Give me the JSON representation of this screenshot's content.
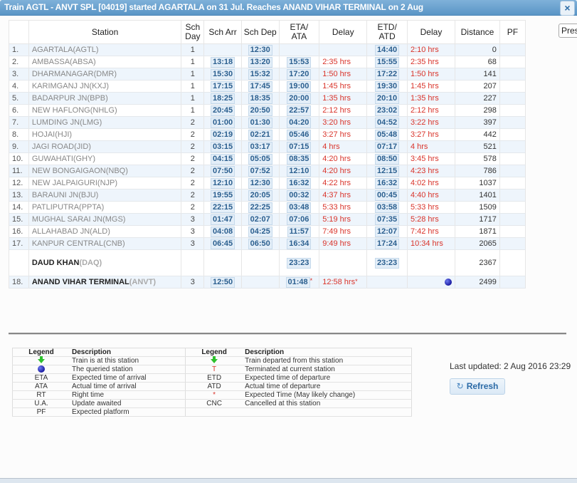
{
  "dialog": {
    "title": "Train AGTL - ANVT SPL [04019] started AGARTALA on 31 Jul. Reaches ANAND VIHAR TERMINAL on 2 Aug",
    "close_icon": "×",
    "side_button_label": "Pres"
  },
  "table": {
    "headers": {
      "num": "",
      "station": "Station",
      "sch_day": "Sch Day",
      "sch_arr": "Sch Arr",
      "sch_dep": "Sch Dep",
      "eta_ata": "ETA/ ATA",
      "arr_delay": "Delay",
      "etd_atd": "ETD/ ATD",
      "dep_delay": "Delay",
      "distance": "Distance",
      "pf": "PF"
    },
    "rows": [
      {
        "num": "1.",
        "station": "AGARTALA(AGTL)",
        "day": "1",
        "sch_arr": "",
        "sch_dep": "12:30",
        "eta": "",
        "arr_delay": "",
        "etd": "14:40",
        "dep_delay": "2:10 hrs",
        "distance": "0",
        "pf": ""
      },
      {
        "num": "2.",
        "station": "AMBASSA(ABSA)",
        "day": "1",
        "sch_arr": "13:18",
        "sch_dep": "13:20",
        "eta": "15:53",
        "arr_delay": "2:35 hrs",
        "etd": "15:55",
        "dep_delay": "2:35 hrs",
        "distance": "68",
        "pf": ""
      },
      {
        "num": "3.",
        "station": "DHARMANAGAR(DMR)",
        "day": "1",
        "sch_arr": "15:30",
        "sch_dep": "15:32",
        "eta": "17:20",
        "arr_delay": "1:50 hrs",
        "etd": "17:22",
        "dep_delay": "1:50 hrs",
        "distance": "141",
        "pf": ""
      },
      {
        "num": "4.",
        "station": "KARIMGANJ JN(KXJ)",
        "day": "1",
        "sch_arr": "17:15",
        "sch_dep": "17:45",
        "eta": "19:00",
        "arr_delay": "1:45 hrs",
        "etd": "19:30",
        "dep_delay": "1:45 hrs",
        "distance": "207",
        "pf": ""
      },
      {
        "num": "5.",
        "station": "BADARPUR JN(BPB)",
        "day": "1",
        "sch_arr": "18:25",
        "sch_dep": "18:35",
        "eta": "20:00",
        "arr_delay": "1:35 hrs",
        "etd": "20:10",
        "dep_delay": "1:35 hrs",
        "distance": "227",
        "pf": ""
      },
      {
        "num": "6.",
        "station": "NEW HAFLONG(NHLG)",
        "day": "1",
        "sch_arr": "20:45",
        "sch_dep": "20:50",
        "eta": "22:57",
        "arr_delay": "2:12 hrs",
        "etd": "23:02",
        "dep_delay": "2:12 hrs",
        "distance": "298",
        "pf": ""
      },
      {
        "num": "7.",
        "station": "LUMDING JN(LMG)",
        "day": "2",
        "sch_arr": "01:00",
        "sch_dep": "01:30",
        "eta": "04:20",
        "arr_delay": "3:20 hrs",
        "etd": "04:52",
        "dep_delay": "3:22 hrs",
        "distance": "397",
        "pf": ""
      },
      {
        "num": "8.",
        "station": "HOJAI(HJI)",
        "day": "2",
        "sch_arr": "02:19",
        "sch_dep": "02:21",
        "eta": "05:46",
        "arr_delay": "3:27 hrs",
        "etd": "05:48",
        "dep_delay": "3:27 hrs",
        "distance": "442",
        "pf": ""
      },
      {
        "num": "9.",
        "station": "JAGI ROAD(JID)",
        "day": "2",
        "sch_arr": "03:15",
        "sch_dep": "03:17",
        "eta": "07:15",
        "arr_delay": "4 hrs",
        "etd": "07:17",
        "dep_delay": "4 hrs",
        "distance": "521",
        "pf": ""
      },
      {
        "num": "10.",
        "station": "GUWAHATI(GHY)",
        "day": "2",
        "sch_arr": "04:15",
        "sch_dep": "05:05",
        "eta": "08:35",
        "arr_delay": "4:20 hrs",
        "etd": "08:50",
        "dep_delay": "3:45 hrs",
        "distance": "578",
        "pf": ""
      },
      {
        "num": "11.",
        "station": "NEW BONGAIGAON(NBQ)",
        "day": "2",
        "sch_arr": "07:50",
        "sch_dep": "07:52",
        "eta": "12:10",
        "arr_delay": "4:20 hrs",
        "etd": "12:15",
        "dep_delay": "4:23 hrs",
        "distance": "786",
        "pf": ""
      },
      {
        "num": "12.",
        "station": "NEW JALPAIGURI(NJP)",
        "day": "2",
        "sch_arr": "12:10",
        "sch_dep": "12:30",
        "eta": "16:32",
        "arr_delay": "4:22 hrs",
        "etd": "16:32",
        "dep_delay": "4:02 hrs",
        "distance": "1037",
        "pf": ""
      },
      {
        "num": "13.",
        "station": "BARAUNI JN(BJU)",
        "day": "2",
        "sch_arr": "19:55",
        "sch_dep": "20:05",
        "eta": "00:32",
        "arr_delay": "4:37 hrs",
        "etd": "00:45",
        "dep_delay": "4:40 hrs",
        "distance": "1401",
        "pf": ""
      },
      {
        "num": "14.",
        "station": "PATLIPUTRA(PPTA)",
        "day": "2",
        "sch_arr": "22:15",
        "sch_dep": "22:25",
        "eta": "03:48",
        "arr_delay": "5:33 hrs",
        "etd": "03:58",
        "dep_delay": "5:33 hrs",
        "distance": "1509",
        "pf": ""
      },
      {
        "num": "15.",
        "station": "MUGHAL SARAI JN(MGS)",
        "day": "3",
        "sch_arr": "01:47",
        "sch_dep": "02:07",
        "eta": "07:06",
        "arr_delay": "5:19 hrs",
        "etd": "07:35",
        "dep_delay": "5:28 hrs",
        "distance": "1717",
        "pf": ""
      },
      {
        "num": "16.",
        "station": "ALLAHABAD JN(ALD)",
        "day": "3",
        "sch_arr": "04:08",
        "sch_dep": "04:25",
        "eta": "11:57",
        "arr_delay": "7:49 hrs",
        "etd": "12:07",
        "dep_delay": "7:42 hrs",
        "distance": "1871",
        "pf": ""
      },
      {
        "num": "17.",
        "station": "KANPUR CENTRAL(CNB)",
        "day": "3",
        "sch_arr": "06:45",
        "sch_dep": "06:50",
        "eta": "16:34",
        "arr_delay": "9:49 hrs",
        "etd": "17:24",
        "dep_delay": "10:34 hrs",
        "distance": "2065",
        "pf": ""
      }
    ],
    "current_station": {
      "name": "DAUD KHAN",
      "code": "(DAQ)",
      "eta": "23:23",
      "etd": "23:23",
      "distance": "2367"
    },
    "destination": {
      "num": "18.",
      "name": "ANAND VIHAR TERMINAL",
      "code": "(ANVT)",
      "day": "3",
      "sch_arr": "12:50",
      "eta": "01:48",
      "eta_mark": "*",
      "arr_delay": "12:58 hrs",
      "delay_mark": "*",
      "marker_icon": "queried-station-dot",
      "distance": "2499"
    }
  },
  "legend": {
    "header_legend": "Legend",
    "header_description": "Description",
    "left": [
      {
        "symbol": "",
        "icon": "green-arrow-icon",
        "description": "Train is at this station"
      },
      {
        "symbol": "",
        "icon": "blue-dot-icon",
        "description": "The queried station"
      },
      {
        "symbol": "ETA",
        "description": "Expected time of arrival"
      },
      {
        "symbol": "ATA",
        "description": "Actual time of arrival"
      },
      {
        "symbol": "RT",
        "description": "Right time"
      },
      {
        "symbol": "U.A.",
        "description": "Update awaited"
      },
      {
        "symbol": "PF",
        "description": "Expected platform"
      }
    ],
    "right": [
      {
        "symbol": "",
        "icon": "green-arrow-icon",
        "description": "Train departed from this station"
      },
      {
        "symbol": "T",
        "description": "Terminated at current station"
      },
      {
        "symbol": "ETD",
        "description": "Expected time of departure"
      },
      {
        "symbol": "ATD",
        "description": "Actual time of departure"
      },
      {
        "symbol": "*",
        "description": "Expected Time (May likely change)"
      },
      {
        "symbol": "CNC",
        "description": "Cancelled at this station"
      },
      {
        "symbol": "",
        "description": ""
      }
    ]
  },
  "status": {
    "last_updated": "Last updated: 2 Aug 2016 23:29",
    "refresh_label": "Refresh",
    "refresh_icon": "↻"
  },
  "colors": {
    "title_bar": "#5a95c6",
    "time_box_bg": "#e3eef8",
    "time_text": "#2b5f8f",
    "delay_red": "#d9342b",
    "separator_green": "#5cc75c",
    "row_alt": "#eef5fc"
  }
}
